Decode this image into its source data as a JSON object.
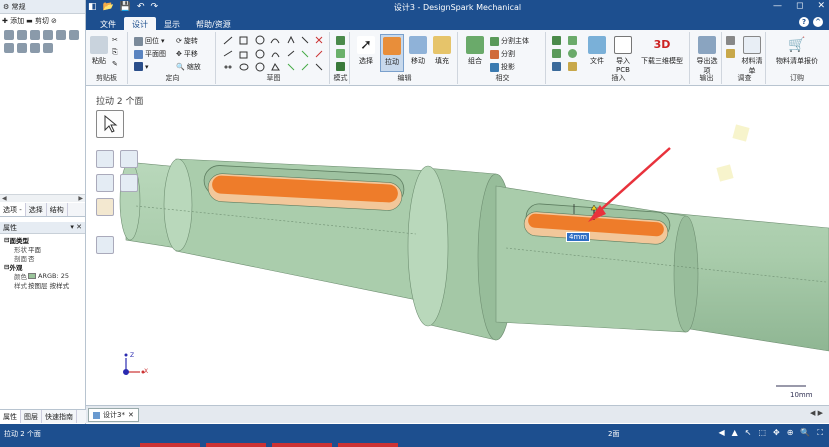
{
  "app": {
    "title": "设计3 - DesignSpark Mechanical",
    "window_buttons": [
      "—",
      "◻",
      "✕"
    ]
  },
  "left_panel": {
    "top_label": "常规",
    "add_label": "添加",
    "cut_label": "剪切",
    "tabs": [
      "选项 -",
      "选择",
      "结构"
    ],
    "properties_title": "属性",
    "properties": {
      "face_type_section": "面类型",
      "shape_key": "形状",
      "shape_val": "平面",
      "chamfer_key": "剖面",
      "chamfer_val": "否",
      "appearance_section": "外观",
      "color_key": "颜色",
      "color_val": "ARGB: 25",
      "style_key": "样式",
      "style_val": "按图层 按样式"
    },
    "bottom_tabs": [
      "属性",
      "图层",
      "快速指南"
    ]
  },
  "menu": {
    "tabs": [
      "文件",
      "设计",
      "显示",
      "帮助/资源"
    ],
    "active": "设计"
  },
  "ribbon": {
    "groups": {
      "clipboard": {
        "label": "剪贴板",
        "paste": "粘贴"
      },
      "orient": {
        "label": "定向",
        "home": "回位",
        "rotate": "旋转",
        "plane": "平面图",
        "pan": "平移",
        "zoom": "缩放"
      },
      "sketch": {
        "label": "草图"
      },
      "mode": {
        "label": "模式"
      },
      "edit": {
        "label": "编辑",
        "select": "选择",
        "pull": "拉动",
        "move": "移动",
        "fill": "填充"
      },
      "intersect": {
        "label": "相交",
        "combine": "组合",
        "split_body": "分割主体",
        "split": "分割",
        "project": "投影"
      },
      "insert": {
        "label": "插入",
        "file": "文件",
        "import_pcb": "导入PCB",
        "download_3d": "下载三维模型"
      },
      "output": {
        "label": "输出",
        "export": "导出选项"
      },
      "investigate": {
        "label": "调查",
        "material": "材料清单"
      },
      "order": {
        "label": "订购",
        "bom": "物料清单报价"
      }
    }
  },
  "viewport": {
    "title": "拉动 2 个面",
    "dimension_value": "4mm",
    "scale_label": "10mm",
    "axis": {
      "x": "X",
      "z": "Z"
    },
    "colors": {
      "shaft": "#a9ccab",
      "shaft_dark": "#8fb693",
      "slot_face": "#ee7c2a",
      "slot_edge": "#f2c79a",
      "arrow": "#e8323c"
    }
  },
  "doc_tabs": {
    "tab_label": "设计3*",
    "nav": "◀ ▶"
  },
  "status": {
    "text": "拉动 2 个面",
    "count": "2面",
    "icons": [
      "◀",
      "▲",
      "↖",
      "⬚",
      "✥",
      "⊕",
      "🔍",
      "⛶"
    ]
  }
}
